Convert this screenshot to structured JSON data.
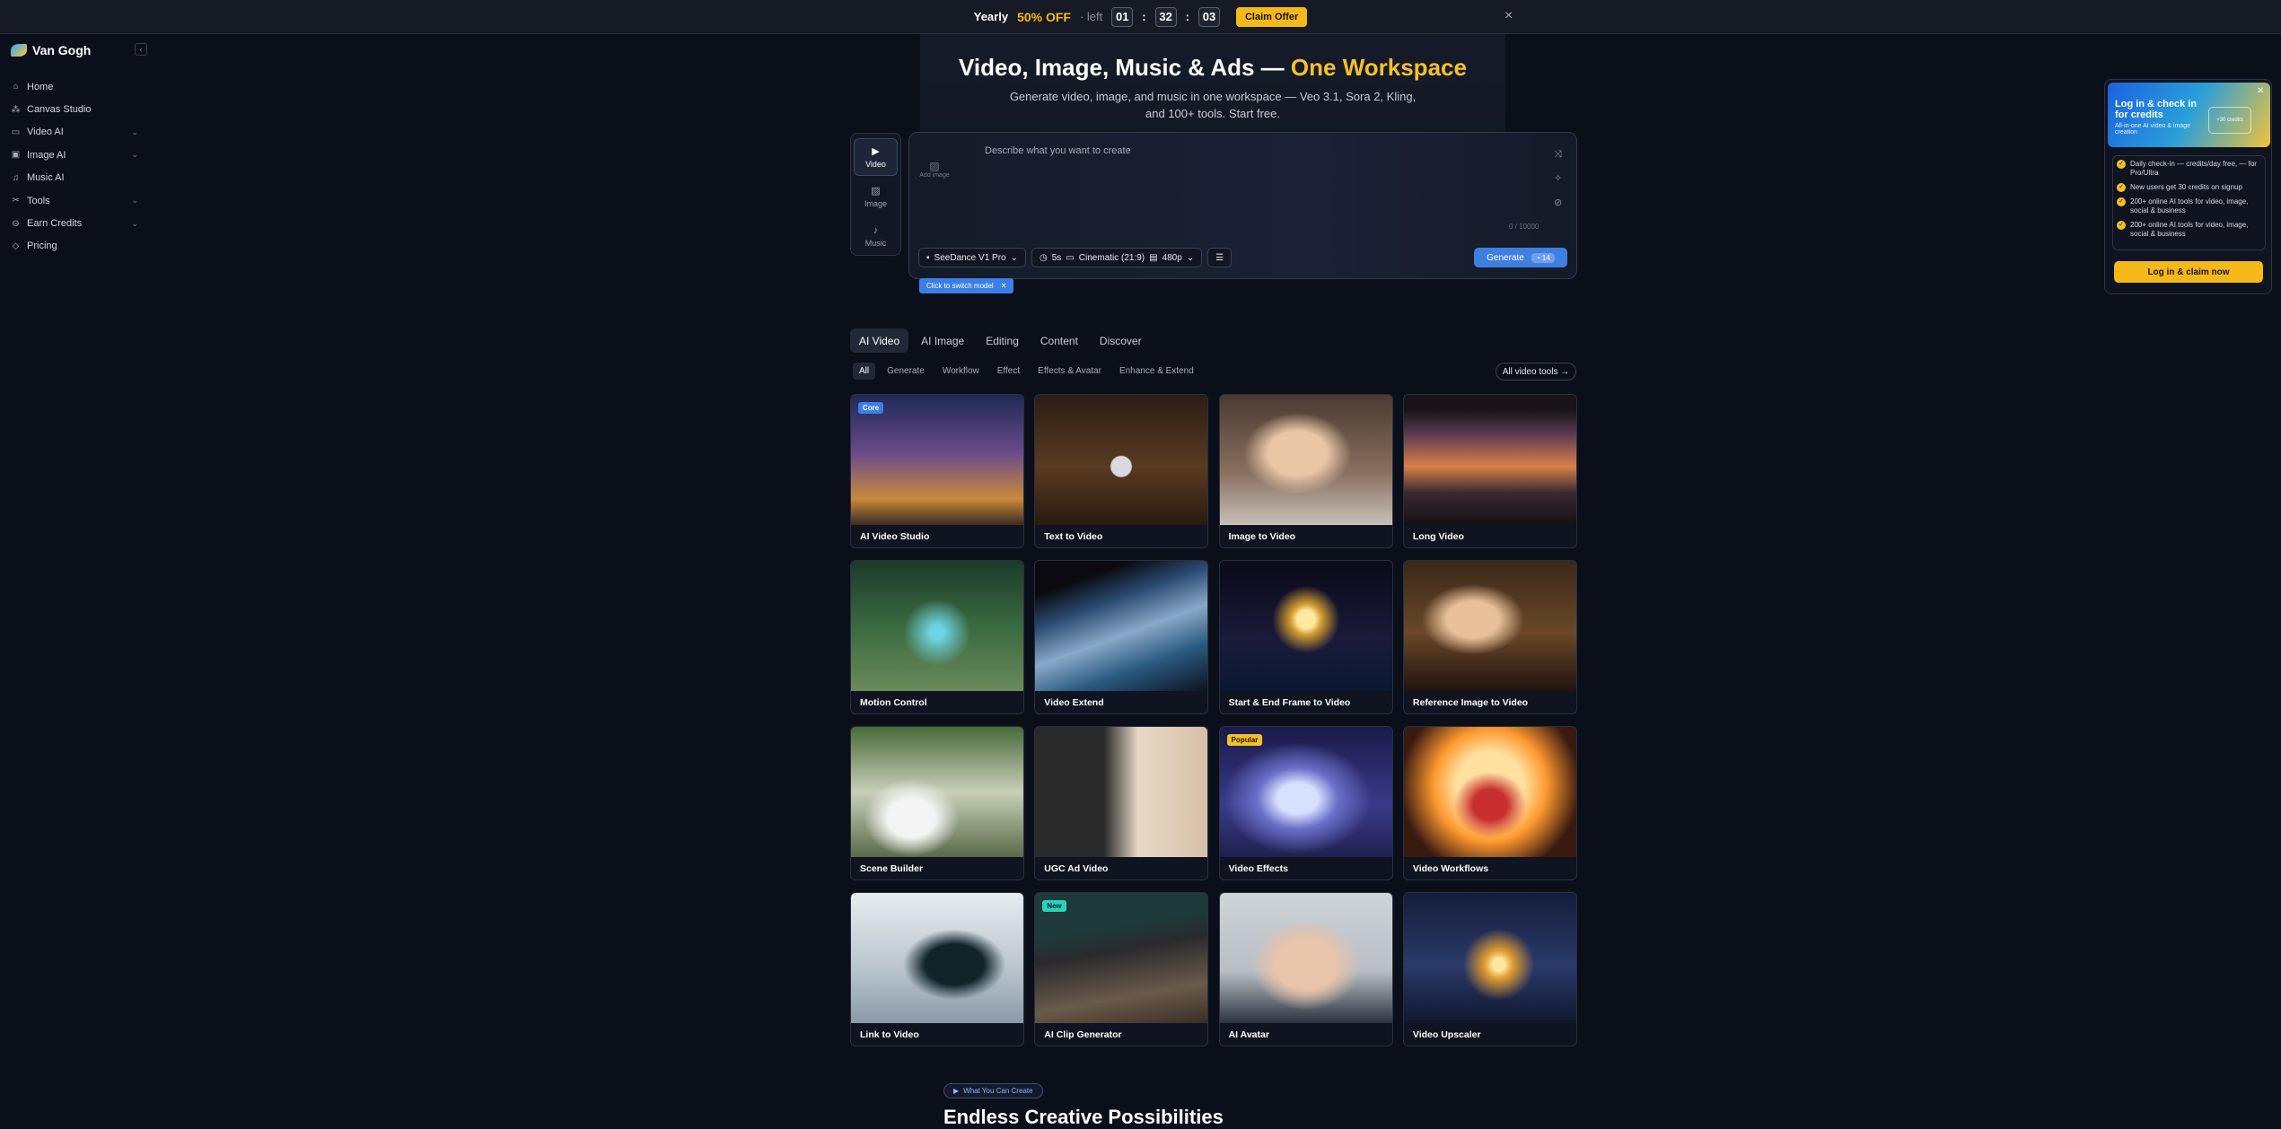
{
  "banner": {
    "yearly": "Yearly",
    "off": "50% OFF",
    "left": "· left",
    "h": "01",
    "m": "32",
    "s": "03",
    "claim": "Claim Offer",
    "close": "×"
  },
  "brand": {
    "name": "Van Gogh"
  },
  "nav": [
    {
      "label": "Home",
      "icon": "⌂",
      "chevron": ""
    },
    {
      "label": "Canvas Studio",
      "icon": "⁂",
      "chevron": ""
    },
    {
      "label": "Video AI",
      "icon": "▭",
      "chevron": "⌄"
    },
    {
      "label": "Image AI",
      "icon": "▣",
      "chevron": "⌄"
    },
    {
      "label": "Music AI",
      "icon": "♫",
      "chevron": ""
    },
    {
      "label": "Tools",
      "icon": "✂",
      "chevron": "⌄"
    },
    {
      "label": "Earn Credits",
      "icon": "⊖",
      "chevron": "⌄"
    },
    {
      "label": "Pricing",
      "icon": "◇",
      "chevron": ""
    }
  ],
  "hero": {
    "title_main": "Video, Image, Music & Ads — ",
    "title_highlight": "One Workspace",
    "subtitle": "Generate video, image, and music in one workspace — Veo 3.1, Sora 2, Kling, and 100+ tools. Start free."
  },
  "modes": [
    {
      "label": "Video",
      "icon": "▶"
    },
    {
      "label": "Image",
      "icon": "▨"
    },
    {
      "label": "Music",
      "icon": "♪"
    }
  ],
  "prompt": {
    "placeholder": "Describe what you want to create",
    "add_image": "Add image",
    "count": "0 / 10000",
    "model": "SeeDance V1 Pro",
    "duration": "5s",
    "ratio": "Cinematic (21:9)",
    "resolution": "480p",
    "generate": "Generate",
    "credits": "14"
  },
  "tooltip": {
    "text": "Click to switch model",
    "close": "✕"
  },
  "promo": {
    "title": "Log in & check in for credits",
    "subtitle": "All-in-one AI video & image creation",
    "close": "✕",
    "card": "+30 credits",
    "items": [
      "Daily check-in — credits/day free, — for Pro/Ultra",
      "New users get 30 credits on signup",
      "200+ online AI tools for video, image, social & business",
      "200+ online AI tools for video, image, social & business"
    ],
    "button": "Log in & claim now"
  },
  "categories": [
    "AI Video",
    "AI Image",
    "Editing",
    "Content",
    "Discover"
  ],
  "filters": [
    "All",
    "Generate",
    "Workflow",
    "Effect",
    "Effects & Avatar",
    "Enhance & Extend"
  ],
  "all_tools": "All video tools →",
  "cards": [
    {
      "label": "AI Video Studio",
      "badge": "Core",
      "bg": "linear-gradient(180deg,#1d2a55 0%,#6b4a8a 45%,#c98a3a 80%,#3a2a20 100%)"
    },
    {
      "label": "Text to Video",
      "badge": "",
      "bg": "radial-gradient(circle at 50% 55%,#d9d9e0 0 9%,transparent 10%),linear-gradient(180deg,#2b1d14,#5a3a22 55%,#2a1a10)"
    },
    {
      "label": "Image to Video",
      "badge": "",
      "bg": "radial-gradient(ellipse at 45% 45%,#e8c6a6 0 22%,transparent 40%),linear-gradient(180deg,#4a3a30,#8a7060 60%,#c8c0b8)"
    },
    {
      "label": "Long Video",
      "badge": "",
      "bg": "linear-gradient(180deg,#1a1418 0 12%,#5a3a50 30%,#d8804a 55%,#3a2a30 75%,#151015 100%)"
    },
    {
      "label": "Motion Control",
      "badge": "",
      "bg": "radial-gradient(circle at 50% 55%,#6cd4e2 0 6%,transparent 30%),linear-gradient(180deg,#1c3a2a,#3a6a40 50%,#6a8a5a)"
    },
    {
      "label": "Video Extend",
      "badge": "",
      "bg": "linear-gradient(160deg,#0a0a10 0 18%,#2a4a70 35%,#8aa8c8 55%,#2a5a80 75%,#0c1420)"
    },
    {
      "label": "Start & End Frame to Video",
      "badge": "",
      "bg": "radial-gradient(circle at 50% 45%,#ffe9a0 0 8%,#d09a30 14%,transparent 30%),linear-gradient(180deg,#0a0a18,#1a1a3a 60%,#0a1830)"
    },
    {
      "label": "Reference Image to Video",
      "badge": "",
      "bg": "radial-gradient(ellipse at 40% 45%,#e8c09a 0 18%,transparent 35%),linear-gradient(180deg,#3a2818,#6a4828 55%,#201410)"
    },
    {
      "label": "Scene Builder",
      "badge": "",
      "bg": "radial-gradient(ellipse at 35% 70%,#f4f4f4 0 15%,transparent 30%),linear-gradient(180deg,#4a6a3a,#c8d0b8 50%,#5a6a4a)"
    },
    {
      "label": "UGC Ad Video",
      "badge": "",
      "bg": "linear-gradient(90deg,#2a2a2a 0 40%,#e8d8c8 60%,#d8c0a8 100%)"
    },
    {
      "label": "Video Effects",
      "badge": "Popular",
      "bg": "radial-gradient(ellipse at 45% 55%,#d8e0ff 0 15%,#6a70c8 30%,transparent 55%),linear-gradient(180deg,#1a1a4a,#3a3a8a 60%,#202050)"
    },
    {
      "label": "Video Workflows",
      "badge": "",
      "bg": "radial-gradient(ellipse at 50% 60%,#c83030 0 14%,transparent 30%),radial-gradient(circle at 50% 45%,#ffe0a0 0 30%,#ff9a30 50%,#3a1a10 80%)"
    },
    {
      "label": "Link to Video",
      "badge": "",
      "bg": "radial-gradient(ellipse at 60% 55%,#10242a 0 20%,transparent 35%),linear-gradient(180deg,#e8ecef,#b8c4cc 60%,#8a9aa8)"
    },
    {
      "label": "AI Clip Generator",
      "badge": "New",
      "bg": "linear-gradient(170deg,#1e3a3a 0 30%,#2a2a2e 45%,#6a5a4a 75%,#3a2e24)"
    },
    {
      "label": "AI Avatar",
      "badge": "",
      "bg": "radial-gradient(ellipse at 50% 55%,#e8c4aa 0 25%,transparent 45%),linear-gradient(180deg,#cfd4d8,#b8bec4 60%,#2a3440)"
    },
    {
      "label": "Video Upscaler",
      "badge": "",
      "bg": "radial-gradient(circle at 55% 55%,#ffe7a0 0 5%,#e09a30 12%,transparent 30%),linear-gradient(180deg,#141c3a,#2a3a6a 55%,#101830)"
    }
  ],
  "footer": {
    "what_you_can_create": "What You Can Create",
    "endless": "Endless Creative Possibilities"
  },
  "colors": {
    "accent": "#f7c02a",
    "primary": "#3f7fe0",
    "bg": "#0b0f1a"
  }
}
